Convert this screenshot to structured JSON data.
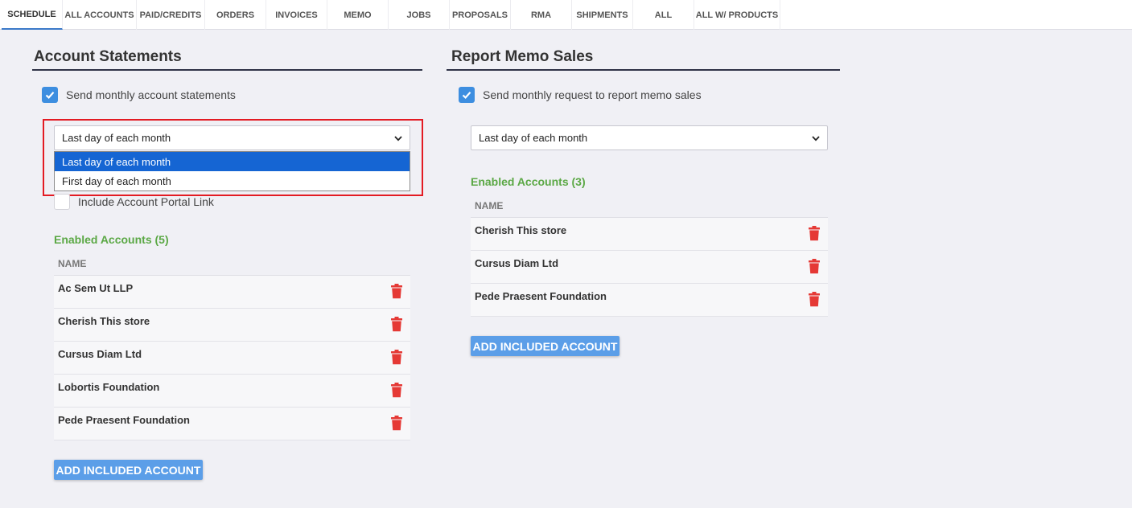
{
  "tabs": [
    "SCHEDULE",
    "ALL ACCOUNTS",
    "PAID/CREDITS",
    "ORDERS",
    "INVOICES",
    "MEMO",
    "JOBS",
    "PROPOSALS",
    "RMA",
    "SHIPMENTS",
    "ALL",
    "ALL W/ PRODUCTS"
  ],
  "active_tab": "SCHEDULE",
  "colors": {
    "accent": "#3d8ee0",
    "enabled_green": "#5ba845",
    "trash_red": "#e53935",
    "highlight_red": "#e31b23",
    "selected_option": "#1565d3"
  },
  "statements": {
    "title": "Account Statements",
    "send_label": "Send monthly account statements",
    "send_checked": true,
    "schedule_value": "Last day of each month",
    "dropdown_options": [
      "Last day of each month",
      "First day of each month"
    ],
    "dropdown_selected": "Last day of each month",
    "portal_label": "Include Account Portal Link",
    "portal_checked": false,
    "enabled_title": "Enabled Accounts (5)",
    "name_header": "NAME",
    "accounts": [
      "Ac Sem Ut LLP",
      "Cherish This store",
      "Cursus Diam Ltd",
      "Lobortis Foundation",
      "Pede Praesent Foundation"
    ],
    "add_label": "ADD INCLUDED ACCOUNT"
  },
  "memo": {
    "title": "Report Memo Sales",
    "send_label": "Send monthly request to report memo sales",
    "send_checked": true,
    "schedule_value": "Last day of each month",
    "enabled_title": "Enabled Accounts (3)",
    "name_header": "NAME",
    "accounts": [
      "Cherish This store",
      "Cursus Diam Ltd",
      "Pede Praesent Foundation"
    ],
    "add_label": "ADD INCLUDED ACCOUNT"
  }
}
